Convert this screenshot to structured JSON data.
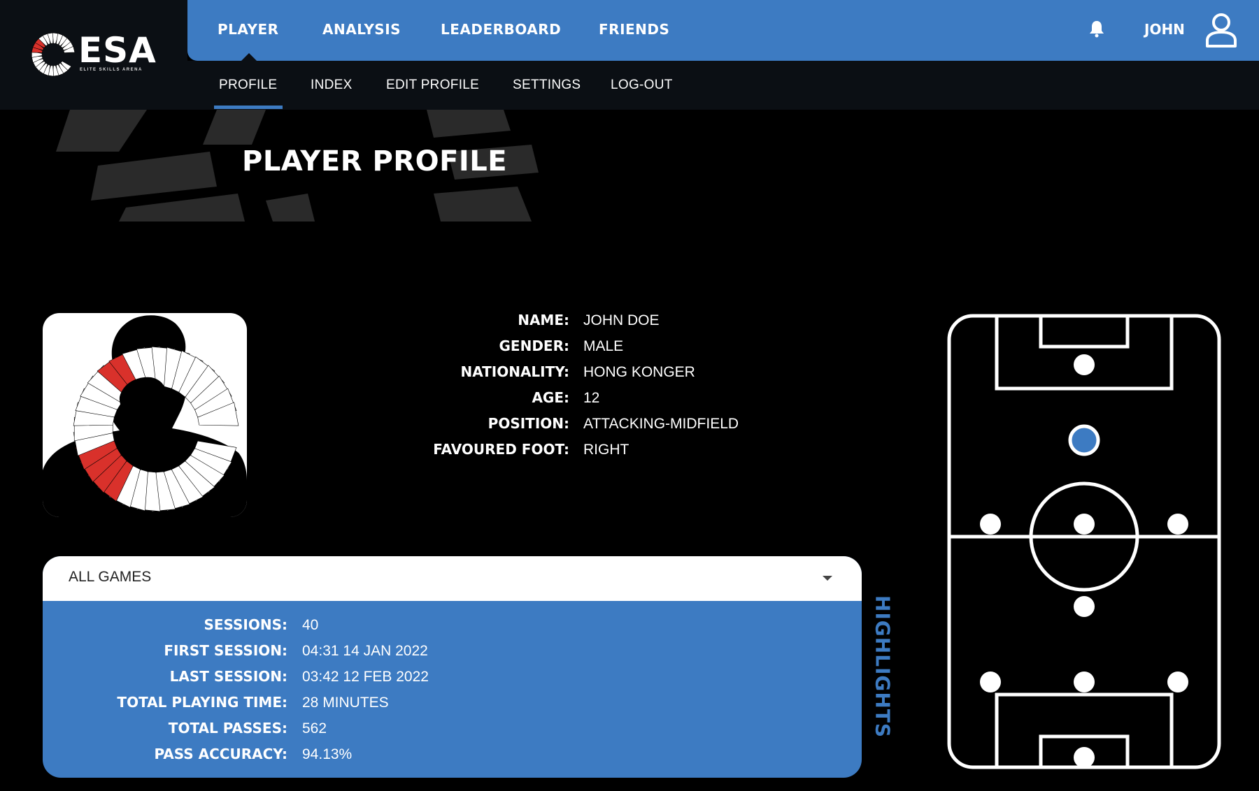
{
  "brand": {
    "logo_text": "ESA",
    "logo_subtitle": "ELITE SKILLS ARENA"
  },
  "topnav": {
    "items": [
      "PLAYER",
      "ANALYSIS",
      "LEADERBOARD",
      "FRIENDS"
    ],
    "active": "PLAYER",
    "user_name": "JOHN",
    "accent_color": "#3d7bc2"
  },
  "subnav": {
    "items": [
      "PROFILE",
      "INDEX",
      "EDIT PROFILE",
      "SETTINGS",
      "LOG-OUT"
    ],
    "active": "PROFILE"
  },
  "page": {
    "title": "PLAYER PROFILE"
  },
  "player": {
    "fields": [
      {
        "label": "NAME:",
        "value": "JOHN DOE"
      },
      {
        "label": "GENDER:",
        "value": "MALE"
      },
      {
        "label": "NATIONALITY:",
        "value": "HONG KONGER"
      },
      {
        "label": "AGE:",
        "value": "12"
      },
      {
        "label": "POSITION:",
        "value": "ATTACKING-MIDFIELD"
      },
      {
        "label": "FAVOURED FOOT:",
        "value": "RIGHT"
      }
    ]
  },
  "stats": {
    "filter": "ALL GAMES",
    "rows": [
      {
        "label": "SESSIONS:",
        "value": "40"
      },
      {
        "label": "FIRST SESSION:",
        "value": "04:31 14 JAN 2022"
      },
      {
        "label": "LAST SESSION:",
        "value": "03:42 12 FEB 2022"
      },
      {
        "label": "TOTAL PLAYING TIME:",
        "value": "28 MINUTES"
      },
      {
        "label": "TOTAL PASSES:",
        "value": "562"
      },
      {
        "label": "PASS ACCURACY:",
        "value": "94.13%"
      }
    ],
    "side_tab": "HIGHLIGHTS"
  },
  "pitch": {
    "highlighted_position": "ATTACKING-MIDFIELD",
    "highlight_color": "#3d7bc2"
  }
}
